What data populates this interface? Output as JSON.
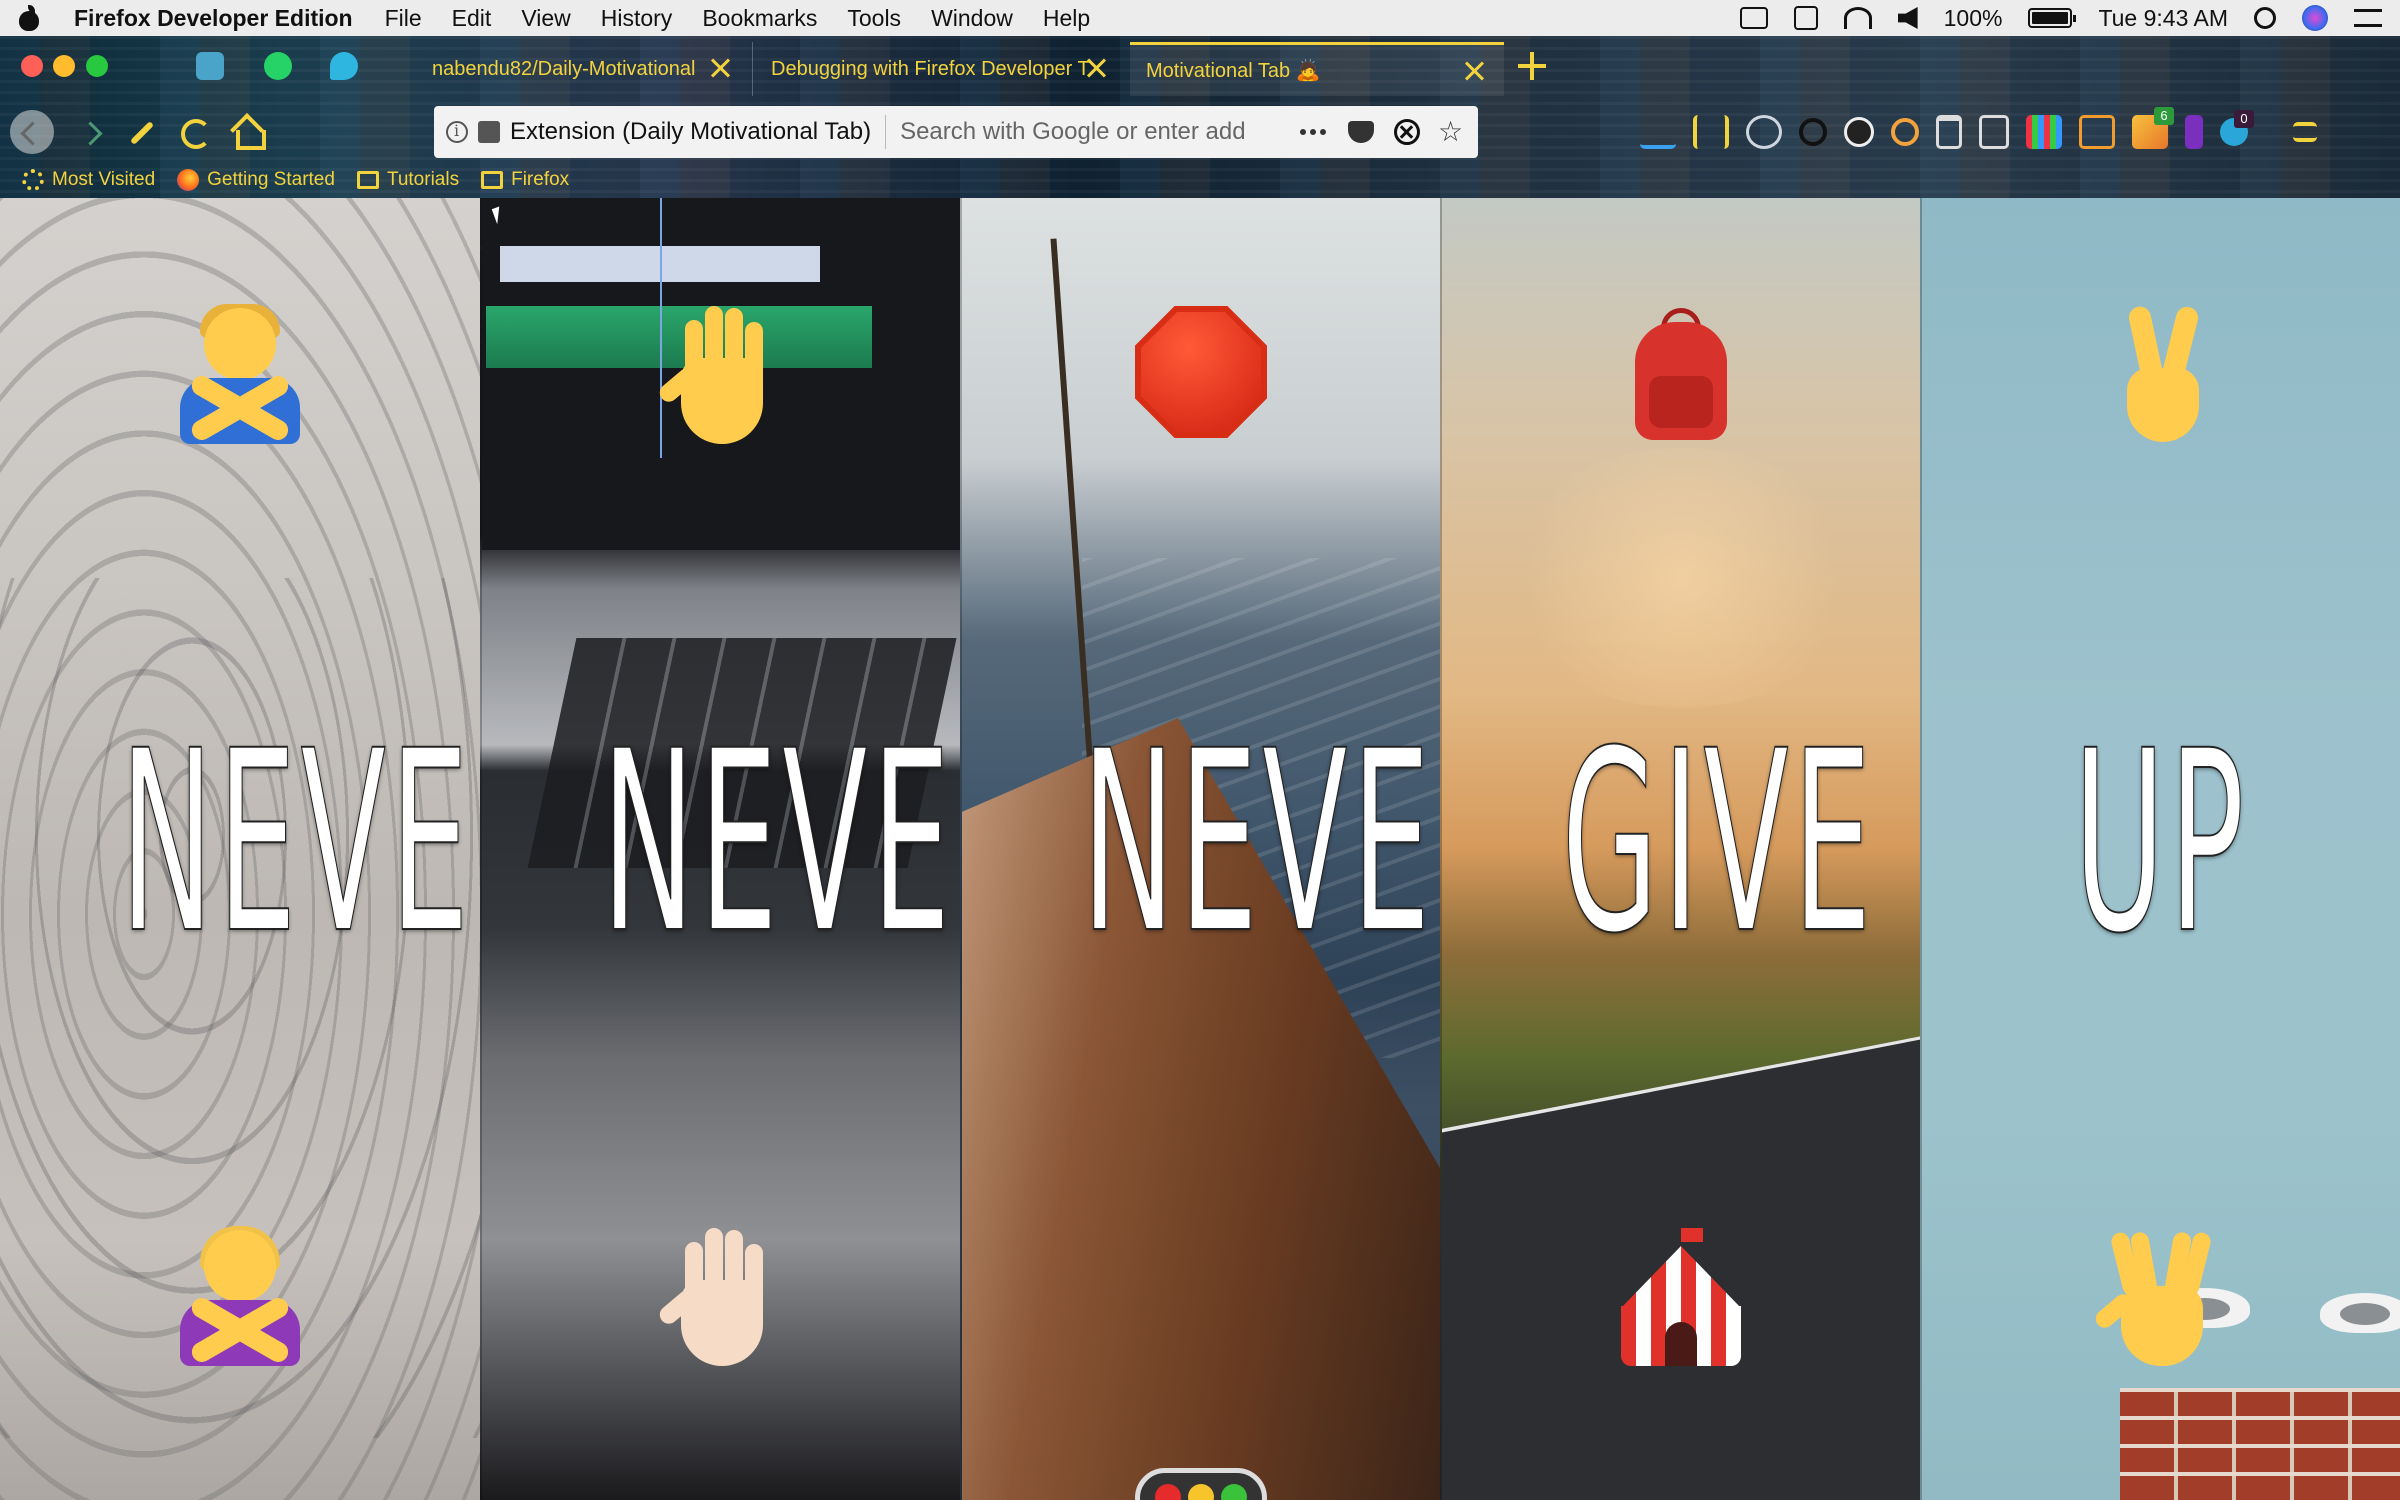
{
  "menubar": {
    "app_name": "Firefox Developer Edition",
    "items": [
      "File",
      "Edit",
      "View",
      "History",
      "Bookmarks",
      "Tools",
      "Window",
      "Help"
    ],
    "battery": "100%",
    "clock": "Tue 9:43 AM"
  },
  "tabs": [
    {
      "label": "nabendu82/Daily-Motivational"
    },
    {
      "label": "Debugging with Firefox Developer T"
    },
    {
      "label": "Motivational Tab 🙇"
    }
  ],
  "urlbar": {
    "identity": "Extension (Daily Motivational Tab)",
    "placeholder": "Search with Google or enter add"
  },
  "toolbar": {
    "badge_1": "6",
    "badge_2": "0"
  },
  "bookmarks": [
    {
      "label": "Most Visited",
      "icon": "gear-icon"
    },
    {
      "label": "Getting Started",
      "icon": "firefox-icon"
    },
    {
      "label": "Tutorials",
      "icon": "folder-icon"
    },
    {
      "label": "Firefox",
      "icon": "folder-icon"
    }
  ],
  "panels": [
    {
      "word": "NEVER",
      "top_emoji": "person-gesturing-no-man",
      "bottom_emoji": "person-gesturing-no-woman"
    },
    {
      "word": "NEVER",
      "top_emoji": "raised-hand",
      "bottom_emoji": "raised-hand-light"
    },
    {
      "word": "NEVER",
      "top_emoji": "stop-sign",
      "bottom_emoji": "traffic-light"
    },
    {
      "word": "GIVE",
      "top_emoji": "backpack",
      "bottom_emoji": "circus-tent"
    },
    {
      "word": "UP",
      "top_emoji": "victory-hand",
      "bottom_emoji": "vulcan-salute"
    }
  ],
  "colors": {
    "theme_accent": "#f3d33d",
    "menubar_bg": "#ececec"
  }
}
